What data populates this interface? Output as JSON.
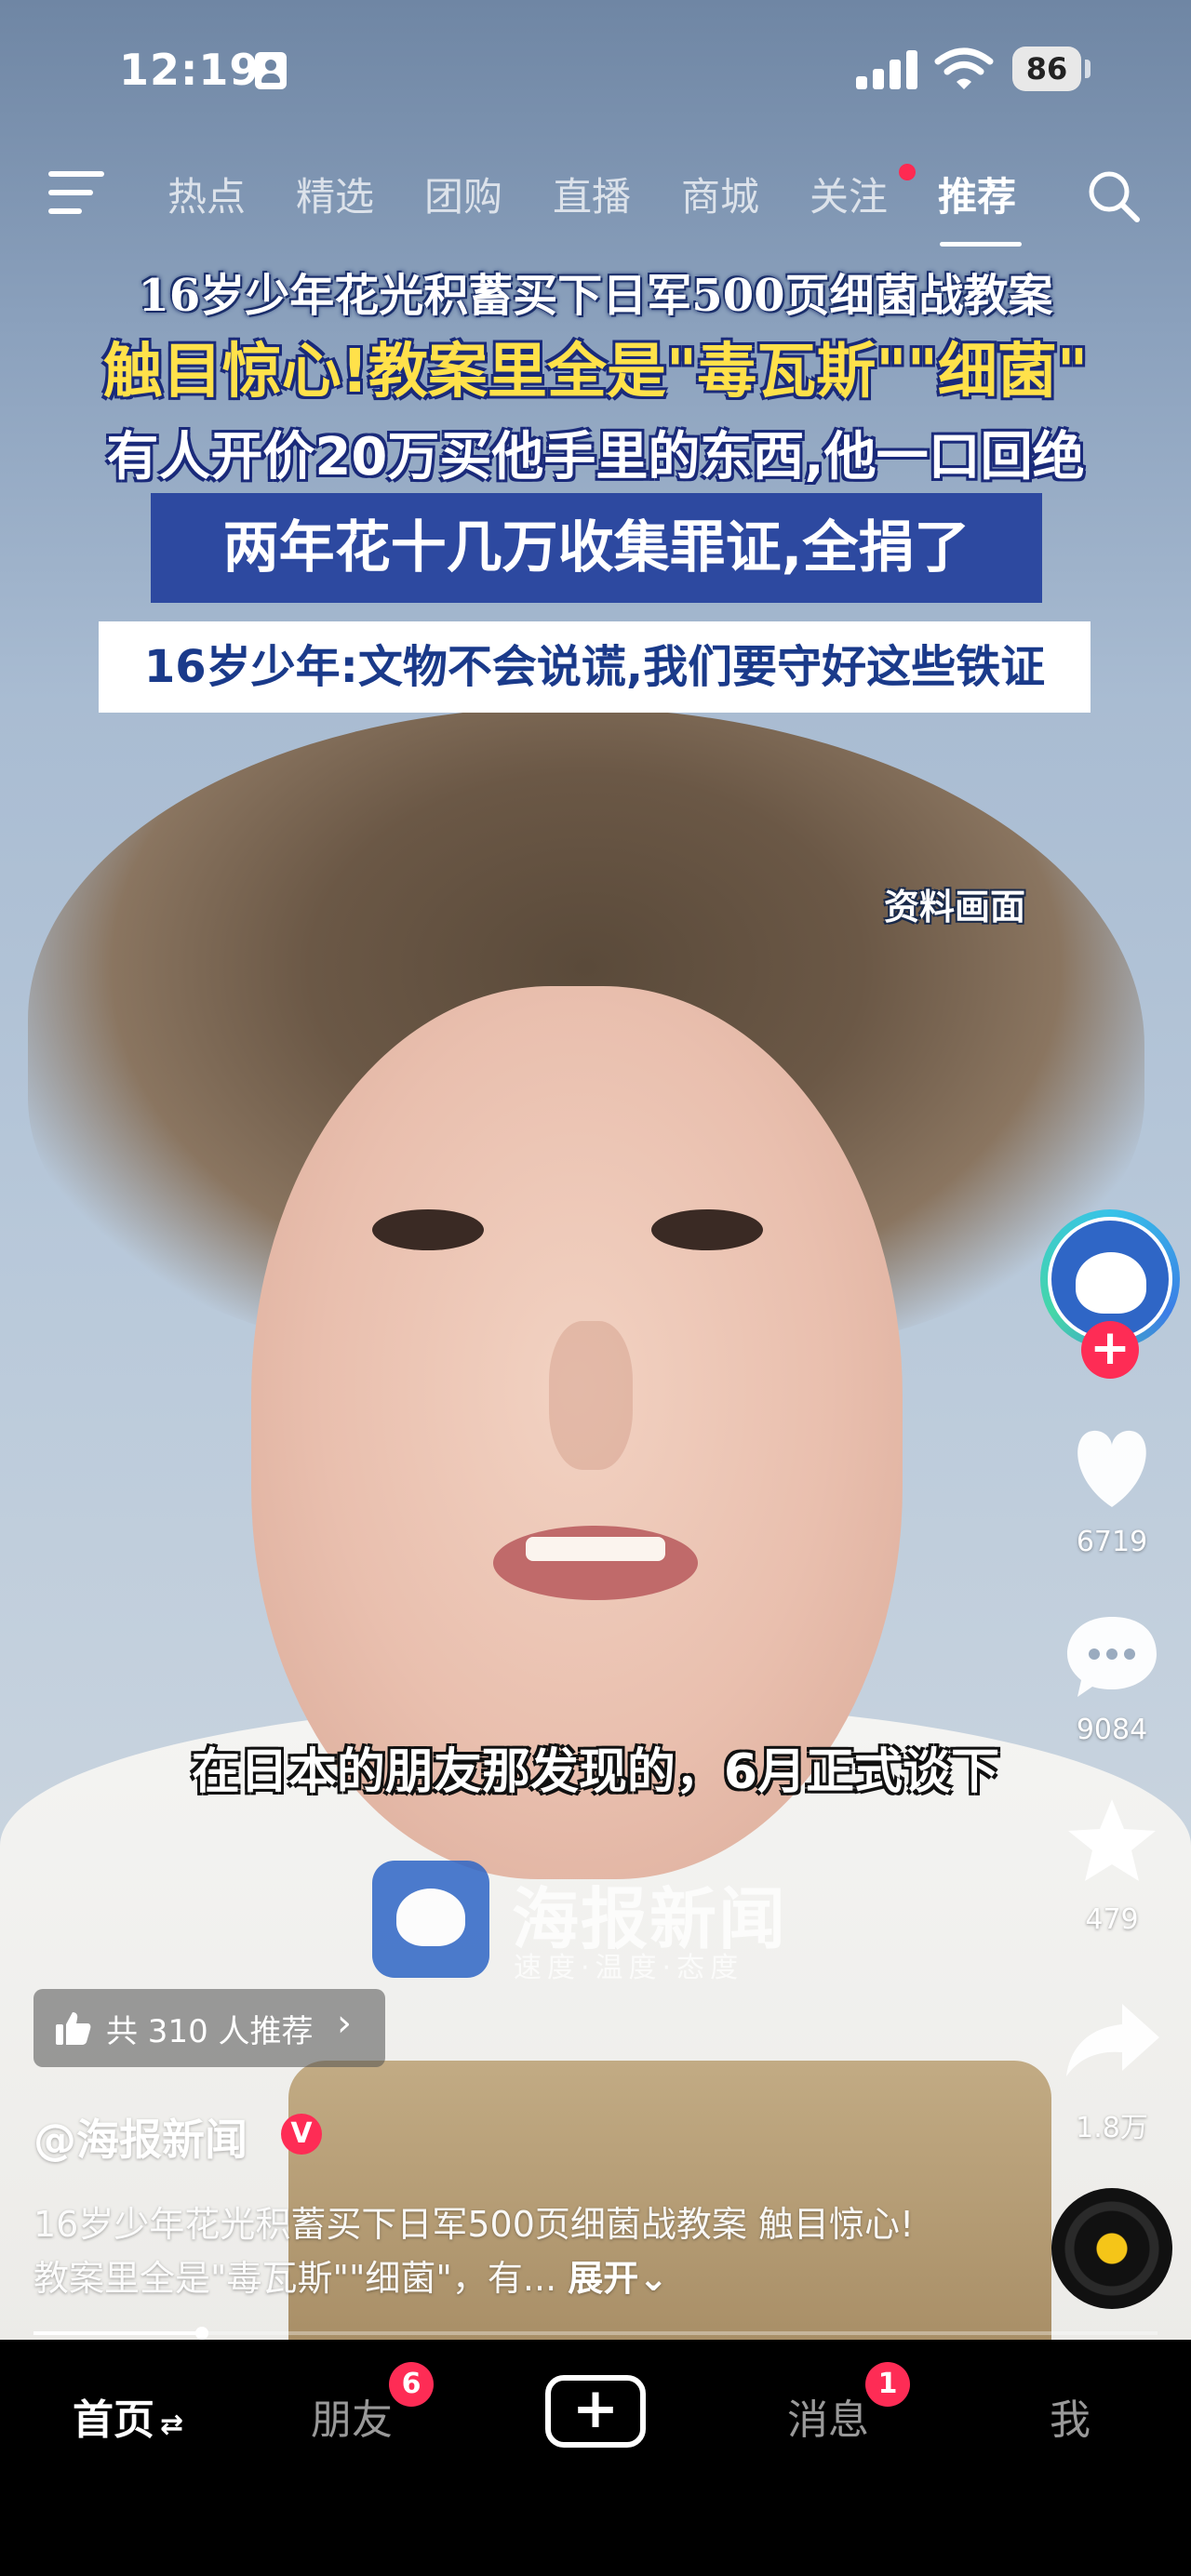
{
  "status_bar": {
    "time": "12:19",
    "battery": "86",
    "icons": [
      "id-card-icon",
      "signal-icon",
      "wifi-icon",
      "battery-icon"
    ]
  },
  "top_nav": {
    "tabs": [
      {
        "label": "热点"
      },
      {
        "label": "精选"
      },
      {
        "label": "团购"
      },
      {
        "label": "直播"
      },
      {
        "label": "商城"
      },
      {
        "label": "关注",
        "has_dot": true
      },
      {
        "label": "推荐",
        "active": true
      }
    ],
    "icons": [
      "menu-icon",
      "search-icon"
    ]
  },
  "video": {
    "captions": {
      "line1": "16岁少年花光积蓄买下日军500页细菌战教案",
      "line2": "触目惊心!教案里全是\"毒瓦斯\"\"细菌\"",
      "line3": "有人开价20万买他手里的东西,他一口回绝",
      "line4": "两年花十几万收集罪证,全捐了",
      "line5": "16岁少年:文物不会说谎,我们要守好这些铁证"
    },
    "archive_label": "资料画面",
    "subtitle": "在日本的朋友那发现的，6月正式谈下",
    "watermark": {
      "name": "海报新闻",
      "slogan": "速度·温度·态度"
    },
    "progress": 0.15
  },
  "side_rail": {
    "follow_label": "+",
    "likes": "6719",
    "comments": "9084",
    "favorites": "479",
    "shares": "1.8万",
    "icons": [
      "avatar",
      "heart-icon",
      "comment-icon",
      "star-icon",
      "share-icon",
      "music-disc-icon"
    ]
  },
  "info": {
    "recommend": "共 310 人推荐",
    "recommend_arrow": "›",
    "author": "@海报新闻",
    "verified": "V",
    "description": "16岁少年花光积蓄买下日军500页细菌战教案 触目惊心!教案里全是\"毒瓦斯\"\"细菌\"，有...",
    "expand": "展开⌄"
  },
  "bottom_nav": {
    "items": [
      {
        "label": "首页",
        "suffix": "⇄",
        "active": true
      },
      {
        "label": "朋友",
        "badge": "6"
      },
      {
        "label": "+"
      },
      {
        "label": "消息",
        "badge": "1"
      },
      {
        "label": "我"
      }
    ]
  },
  "colors": {
    "accent": "#fe2c55",
    "caption_yellow": "#ffe14a",
    "caption_blue_box": "#2d49a0",
    "caption_text_blue": "#1a3a8a"
  }
}
